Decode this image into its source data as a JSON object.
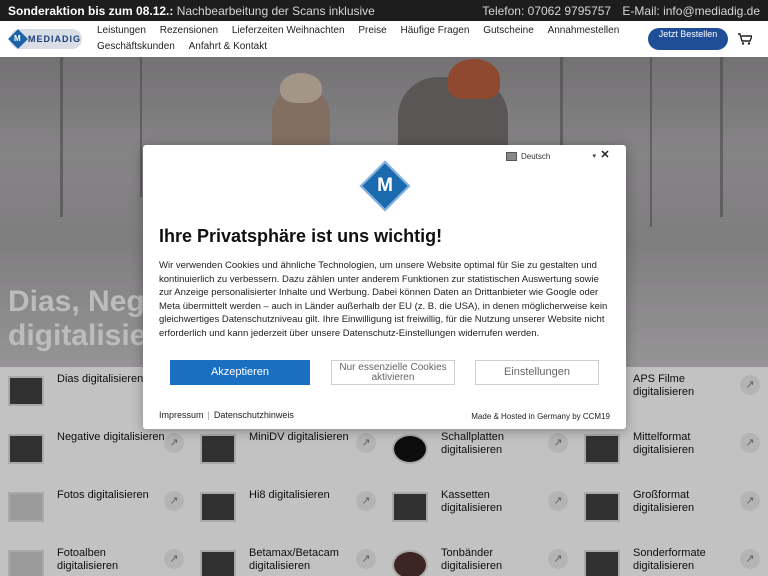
{
  "topbar": {
    "promo_bold": "Sonderaktion bis zum 08.12.:",
    "promo_text": "Nachbearbeitung der Scans inklusive",
    "phone": "Telefon: 07062 9795757",
    "email": "E-Mail: info@mediadig.de"
  },
  "header": {
    "logo_text": "MEDIADIG",
    "logo_mark": "M",
    "nav": [
      "Leistungen",
      "Rezensionen",
      "Lieferzeiten Weihnachten",
      "Preise",
      "Häufige Fragen",
      "Gutscheine",
      "Annahmestellen",
      "Geschäftskunden",
      "Anfahrt & Kontakt"
    ],
    "cta": "Jetzt Bestellen",
    "cart_icon": "cart-icon"
  },
  "hero": {
    "title_line1": "Dias, Neg",
    "title_line2": "digitalisie"
  },
  "services": [
    {
      "label": "Dias digitalisieren",
      "col": 0
    },
    {
      "label": "",
      "col": 1
    },
    {
      "label": "",
      "col": 2
    },
    {
      "label": "APS Filme digitalisieren",
      "col": 3
    },
    {
      "label": "Negative digitalisieren",
      "col": 0
    },
    {
      "label": "MiniDV digitalisieren",
      "col": 1
    },
    {
      "label": "Schallplatten digitalisieren",
      "col": 2
    },
    {
      "label": "Mittelformat digitalisieren",
      "col": 3
    },
    {
      "label": "Fotos digitalisieren",
      "col": 0
    },
    {
      "label": "Hi8 digitalisieren",
      "col": 1
    },
    {
      "label": "Kassetten digitalisieren",
      "col": 2
    },
    {
      "label": "Großformat digitalisieren",
      "col": 3
    },
    {
      "label": "Fotoalben digitalisieren",
      "col": 0
    },
    {
      "label": "Betamax/Betacam digitalisieren",
      "col": 1
    },
    {
      "label": "Tonbänder digitalisieren",
      "col": 2
    },
    {
      "label": "Sonderformate digitalisieren",
      "col": 3
    }
  ],
  "consent": {
    "language": "Deutsch",
    "logo_letter": "M",
    "title": "Ihre Privatsphäre ist uns wichtig!",
    "text": "Wir verwenden Cookies und ähnliche Technologien, um unsere Website optimal für Sie zu gestalten und kontinuierlich zu verbessern. Dazu zählen unter anderem Funktionen zur statistischen Auswertung sowie zur Anzeige personalisierter Inhalte und Werbung. Dabei können Daten an Drittanbieter wie Google oder Meta übermittelt werden – auch in Länder außerhalb der EU (z. B. die USA), in denen möglicherweise kein gleichwertiges Datenschutzniveau gilt. Ihre Einwilligung ist freiwillig, für die Nutzung unserer Website nicht erforderlich und kann jederzeit über unsere Datenschutz-Einstellungen widerrufen werden.",
    "accept": "Akzeptieren",
    "essential": "Nur essenzielle Cookies aktivieren",
    "settings": "Einstellungen",
    "impressum": "Impressum",
    "privacy": "Datenschutzhinweis",
    "hosted": "Made & Hosted in Germany by CCM19"
  },
  "colors": {
    "accent": "#1a6fc2",
    "header_cta": "#1f4e96",
    "topbar_bg": "#1d1d1d"
  }
}
